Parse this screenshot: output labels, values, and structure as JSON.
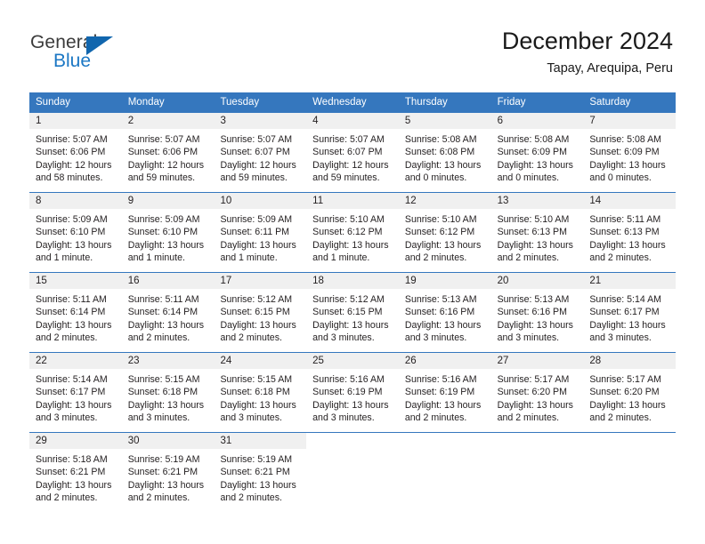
{
  "brand": {
    "name_top": "General",
    "name_bottom": "Blue",
    "accent_color": "#1166ae",
    "text_color": "#3b3b3b"
  },
  "header": {
    "title": "December 2024",
    "subtitle": "Tapay, Arequipa, Peru"
  },
  "theme": {
    "header_blue": "#3577be",
    "day_number_band": "#f0f0f0",
    "text": "#231f20"
  },
  "calendar": {
    "weekday_headers": [
      "Sunday",
      "Monday",
      "Tuesday",
      "Wednesday",
      "Thursday",
      "Friday",
      "Saturday"
    ],
    "weeks": [
      [
        {
          "day": "1",
          "sunrise": "Sunrise: 5:07 AM",
          "sunset": "Sunset: 6:06 PM",
          "daylight_1": "Daylight: 12 hours",
          "daylight_2": "and 58 minutes."
        },
        {
          "day": "2",
          "sunrise": "Sunrise: 5:07 AM",
          "sunset": "Sunset: 6:06 PM",
          "daylight_1": "Daylight: 12 hours",
          "daylight_2": "and 59 minutes."
        },
        {
          "day": "3",
          "sunrise": "Sunrise: 5:07 AM",
          "sunset": "Sunset: 6:07 PM",
          "daylight_1": "Daylight: 12 hours",
          "daylight_2": "and 59 minutes."
        },
        {
          "day": "4",
          "sunrise": "Sunrise: 5:07 AM",
          "sunset": "Sunset: 6:07 PM",
          "daylight_1": "Daylight: 12 hours",
          "daylight_2": "and 59 minutes."
        },
        {
          "day": "5",
          "sunrise": "Sunrise: 5:08 AM",
          "sunset": "Sunset: 6:08 PM",
          "daylight_1": "Daylight: 13 hours",
          "daylight_2": "and 0 minutes."
        },
        {
          "day": "6",
          "sunrise": "Sunrise: 5:08 AM",
          "sunset": "Sunset: 6:09 PM",
          "daylight_1": "Daylight: 13 hours",
          "daylight_2": "and 0 minutes."
        },
        {
          "day": "7",
          "sunrise": "Sunrise: 5:08 AM",
          "sunset": "Sunset: 6:09 PM",
          "daylight_1": "Daylight: 13 hours",
          "daylight_2": "and 0 minutes."
        }
      ],
      [
        {
          "day": "8",
          "sunrise": "Sunrise: 5:09 AM",
          "sunset": "Sunset: 6:10 PM",
          "daylight_1": "Daylight: 13 hours",
          "daylight_2": "and 1 minute."
        },
        {
          "day": "9",
          "sunrise": "Sunrise: 5:09 AM",
          "sunset": "Sunset: 6:10 PM",
          "daylight_1": "Daylight: 13 hours",
          "daylight_2": "and 1 minute."
        },
        {
          "day": "10",
          "sunrise": "Sunrise: 5:09 AM",
          "sunset": "Sunset: 6:11 PM",
          "daylight_1": "Daylight: 13 hours",
          "daylight_2": "and 1 minute."
        },
        {
          "day": "11",
          "sunrise": "Sunrise: 5:10 AM",
          "sunset": "Sunset: 6:12 PM",
          "daylight_1": "Daylight: 13 hours",
          "daylight_2": "and 1 minute."
        },
        {
          "day": "12",
          "sunrise": "Sunrise: 5:10 AM",
          "sunset": "Sunset: 6:12 PM",
          "daylight_1": "Daylight: 13 hours",
          "daylight_2": "and 2 minutes."
        },
        {
          "day": "13",
          "sunrise": "Sunrise: 5:10 AM",
          "sunset": "Sunset: 6:13 PM",
          "daylight_1": "Daylight: 13 hours",
          "daylight_2": "and 2 minutes."
        },
        {
          "day": "14",
          "sunrise": "Sunrise: 5:11 AM",
          "sunset": "Sunset: 6:13 PM",
          "daylight_1": "Daylight: 13 hours",
          "daylight_2": "and 2 minutes."
        }
      ],
      [
        {
          "day": "15",
          "sunrise": "Sunrise: 5:11 AM",
          "sunset": "Sunset: 6:14 PM",
          "daylight_1": "Daylight: 13 hours",
          "daylight_2": "and 2 minutes."
        },
        {
          "day": "16",
          "sunrise": "Sunrise: 5:11 AM",
          "sunset": "Sunset: 6:14 PM",
          "daylight_1": "Daylight: 13 hours",
          "daylight_2": "and 2 minutes."
        },
        {
          "day": "17",
          "sunrise": "Sunrise: 5:12 AM",
          "sunset": "Sunset: 6:15 PM",
          "daylight_1": "Daylight: 13 hours",
          "daylight_2": "and 2 minutes."
        },
        {
          "day": "18",
          "sunrise": "Sunrise: 5:12 AM",
          "sunset": "Sunset: 6:15 PM",
          "daylight_1": "Daylight: 13 hours",
          "daylight_2": "and 3 minutes."
        },
        {
          "day": "19",
          "sunrise": "Sunrise: 5:13 AM",
          "sunset": "Sunset: 6:16 PM",
          "daylight_1": "Daylight: 13 hours",
          "daylight_2": "and 3 minutes."
        },
        {
          "day": "20",
          "sunrise": "Sunrise: 5:13 AM",
          "sunset": "Sunset: 6:16 PM",
          "daylight_1": "Daylight: 13 hours",
          "daylight_2": "and 3 minutes."
        },
        {
          "day": "21",
          "sunrise": "Sunrise: 5:14 AM",
          "sunset": "Sunset: 6:17 PM",
          "daylight_1": "Daylight: 13 hours",
          "daylight_2": "and 3 minutes."
        }
      ],
      [
        {
          "day": "22",
          "sunrise": "Sunrise: 5:14 AM",
          "sunset": "Sunset: 6:17 PM",
          "daylight_1": "Daylight: 13 hours",
          "daylight_2": "and 3 minutes."
        },
        {
          "day": "23",
          "sunrise": "Sunrise: 5:15 AM",
          "sunset": "Sunset: 6:18 PM",
          "daylight_1": "Daylight: 13 hours",
          "daylight_2": "and 3 minutes."
        },
        {
          "day": "24",
          "sunrise": "Sunrise: 5:15 AM",
          "sunset": "Sunset: 6:18 PM",
          "daylight_1": "Daylight: 13 hours",
          "daylight_2": "and 3 minutes."
        },
        {
          "day": "25",
          "sunrise": "Sunrise: 5:16 AM",
          "sunset": "Sunset: 6:19 PM",
          "daylight_1": "Daylight: 13 hours",
          "daylight_2": "and 3 minutes."
        },
        {
          "day": "26",
          "sunrise": "Sunrise: 5:16 AM",
          "sunset": "Sunset: 6:19 PM",
          "daylight_1": "Daylight: 13 hours",
          "daylight_2": "and 2 minutes."
        },
        {
          "day": "27",
          "sunrise": "Sunrise: 5:17 AM",
          "sunset": "Sunset: 6:20 PM",
          "daylight_1": "Daylight: 13 hours",
          "daylight_2": "and 2 minutes."
        },
        {
          "day": "28",
          "sunrise": "Sunrise: 5:17 AM",
          "sunset": "Sunset: 6:20 PM",
          "daylight_1": "Daylight: 13 hours",
          "daylight_2": "and 2 minutes."
        }
      ],
      [
        {
          "day": "29",
          "sunrise": "Sunrise: 5:18 AM",
          "sunset": "Sunset: 6:21 PM",
          "daylight_1": "Daylight: 13 hours",
          "daylight_2": "and 2 minutes."
        },
        {
          "day": "30",
          "sunrise": "Sunrise: 5:19 AM",
          "sunset": "Sunset: 6:21 PM",
          "daylight_1": "Daylight: 13 hours",
          "daylight_2": "and 2 minutes."
        },
        {
          "day": "31",
          "sunrise": "Sunrise: 5:19 AM",
          "sunset": "Sunset: 6:21 PM",
          "daylight_1": "Daylight: 13 hours",
          "daylight_2": "and 2 minutes."
        },
        {
          "day": "",
          "sunrise": "",
          "sunset": "",
          "daylight_1": "",
          "daylight_2": ""
        },
        {
          "day": "",
          "sunrise": "",
          "sunset": "",
          "daylight_1": "",
          "daylight_2": ""
        },
        {
          "day": "",
          "sunrise": "",
          "sunset": "",
          "daylight_1": "",
          "daylight_2": ""
        },
        {
          "day": "",
          "sunrise": "",
          "sunset": "",
          "daylight_1": "",
          "daylight_2": ""
        }
      ]
    ]
  }
}
